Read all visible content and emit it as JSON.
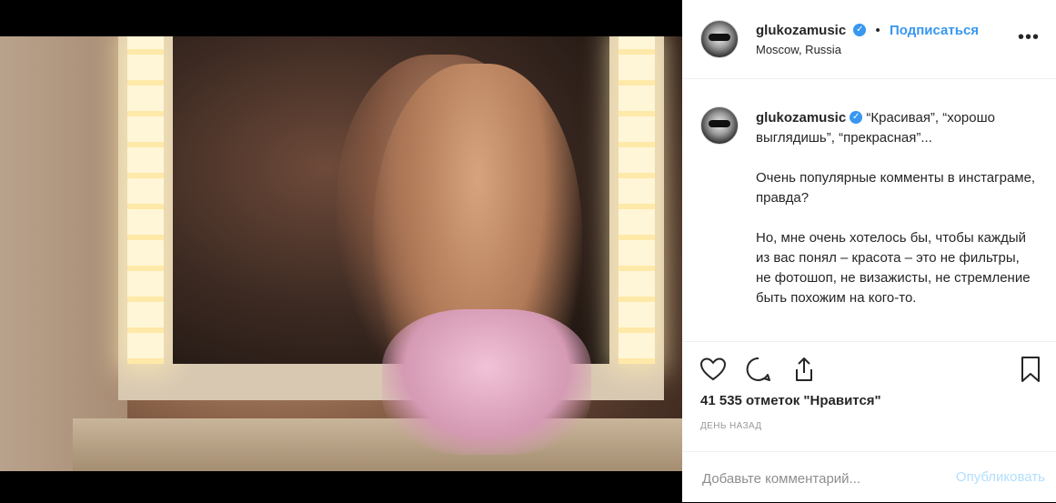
{
  "post": {
    "username": "glukozamusic",
    "follow_label": "Подписаться",
    "separator": "•",
    "location": "Moscow, Russia",
    "more_label": "•••"
  },
  "caption": {
    "username": "glukozamusic",
    "paragraphs": [
      "“Красивая”, “хорошо выглядишь”, “прекрасная”...",
      "Очень популярные комменты в инстаграме, правда?",
      "Но, мне очень хотелось бы, чтобы каждый из вас понял – красота – это не фильтры, не фотошоп, не визажисты, не стремление быть похожим на кого-то."
    ]
  },
  "actions": {
    "icons": [
      "heart-icon",
      "comment-icon",
      "share-icon",
      "bookmark-icon"
    ]
  },
  "likes_text": "41 535 отметок \"Нравится\"",
  "time_text": "ДЕНЬ НАЗАД",
  "comment_box": {
    "placeholder": "Добавьте комментарий...",
    "publish_label": "Опубликовать"
  },
  "colors": {
    "accent": "#3897f0",
    "publish_disabled": "#b2dffc",
    "muted": "#8e8e8e"
  }
}
